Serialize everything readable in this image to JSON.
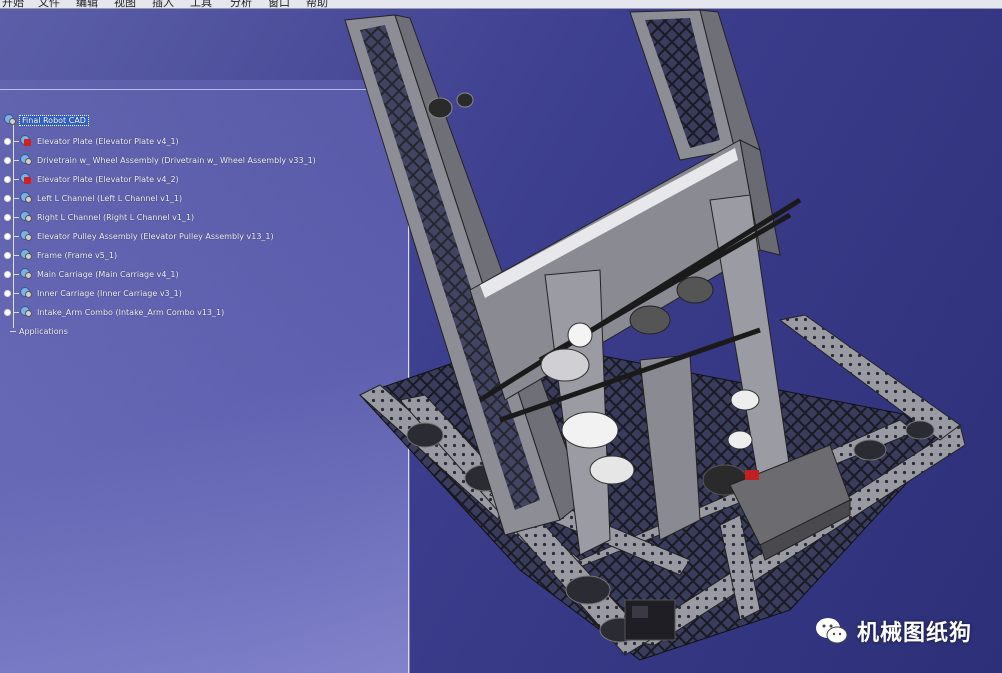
{
  "menubar": {
    "items": [
      "开始",
      "文件",
      "编辑",
      "视图",
      "插入",
      "工具",
      "分析",
      "窗口",
      "帮助"
    ]
  },
  "specification_tree": {
    "root": "Final Robot CAD",
    "children": [
      {
        "label": "Elevator Plate (Elevator Plate v4_1)",
        "icon": "part-update-icon"
      },
      {
        "label": "Drivetrain w_ Wheel Assembly (Drivetrain w_ Wheel Assembly v33_1)",
        "icon": "product-icon"
      },
      {
        "label": "Elevator Plate (Elevator Plate v4_2)",
        "icon": "part-update-icon"
      },
      {
        "label": "Left L Channel (Left L Channel v1_1)",
        "icon": "product-icon"
      },
      {
        "label": "Right L Channel (Right L Channel v1_1)",
        "icon": "product-icon"
      },
      {
        "label": "Elevator Pulley Assembly (Elevator Pulley Assembly v13_1)",
        "icon": "product-icon"
      },
      {
        "label": "Frame (Frame v5_1)",
        "icon": "product-icon"
      },
      {
        "label": "Main Carriage (Main Carriage v4_1)",
        "icon": "product-icon"
      },
      {
        "label": "Inner Carriage (Inner Carriage v3_1)",
        "icon": "product-icon"
      },
      {
        "label": "Intake_Arm Combo (Intake_Arm Combo v13_1)",
        "icon": "product-icon"
      }
    ],
    "footer": "Applications"
  },
  "watermark": {
    "icon": "wechat-icon",
    "text": "机械图纸狗"
  },
  "colors": {
    "background_dark": "#2d2f78",
    "background_light": "#5c5fa8",
    "selection": "#2f62c8",
    "model_metal": "#8d8d95"
  }
}
